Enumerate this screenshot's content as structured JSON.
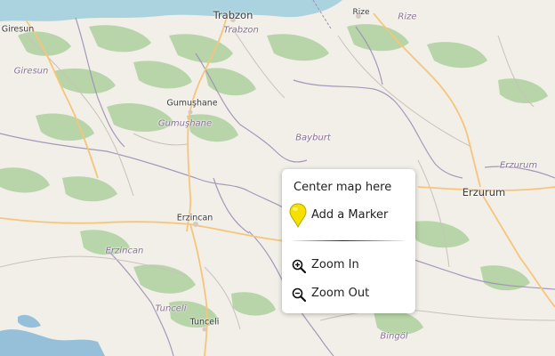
{
  "map": {
    "labels": {
      "trabzon_city": "Trabzon",
      "trabzon_region": "Trabzon",
      "rize_city": "Rize",
      "rize_region": "Rize",
      "giresun_city": "Giresun",
      "giresun_region": "Giresun",
      "gumushane_city": "Gumuşhane",
      "gumushane_region": "Gumuşhane",
      "bayburt_region": "Bayburt",
      "erzincan_city": "Erzincan",
      "erzincan_region": "Erzincan",
      "erzurum_city": "Erzurum",
      "erzurum_region": "Erzurum",
      "tunceli_city": "Tunceli",
      "tunceli_region": "Tunceli",
      "bingol_region": "Bingöl"
    },
    "colors": {
      "land": "#f1efe8",
      "sea": "#aad3df",
      "forest": "#add19e",
      "border": "#9e8fb5",
      "road_major": "#f6c57a",
      "road_minor": "#c9c2bb",
      "water": "#7fb3d5"
    }
  },
  "context_menu": {
    "center_map": "Center map here",
    "add_marker": "Add a Marker",
    "zoom_in": "Zoom In",
    "zoom_out": "Zoom Out",
    "marker_color": "#f5e000",
    "icons": {
      "marker": "map-pin-marker-icon",
      "zoom_in": "magnifier-plus-icon",
      "zoom_out": "magnifier-minus-icon"
    }
  }
}
